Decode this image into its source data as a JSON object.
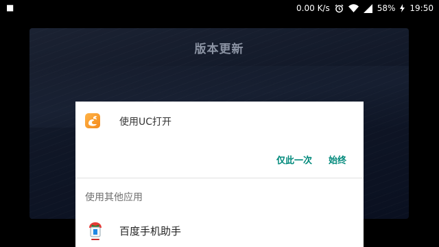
{
  "status_bar": {
    "notification": "■",
    "net_speed": "0.00 K/s",
    "alarm_icon": "alarm-icon",
    "wifi_icon": "wifi-icon",
    "signal_icon": "signal-icon",
    "battery": "58%",
    "charging_icon": "bolt-icon",
    "time": "19:50"
  },
  "update_dialog": {
    "title": "版本更新"
  },
  "chooser": {
    "primary_app_label": "使用UC打开",
    "primary_app_icon": "uc-browser-icon",
    "just_once": "仅此一次",
    "always": "始终",
    "other_apps_heading": "使用其他应用",
    "apps": [
      {
        "name": "百度手机助手",
        "icon": "baidu-assistant-icon"
      }
    ]
  },
  "colors": {
    "accent": "#00897b",
    "uc_orange": "#f39a2b",
    "dialog_bg": "#111828"
  }
}
